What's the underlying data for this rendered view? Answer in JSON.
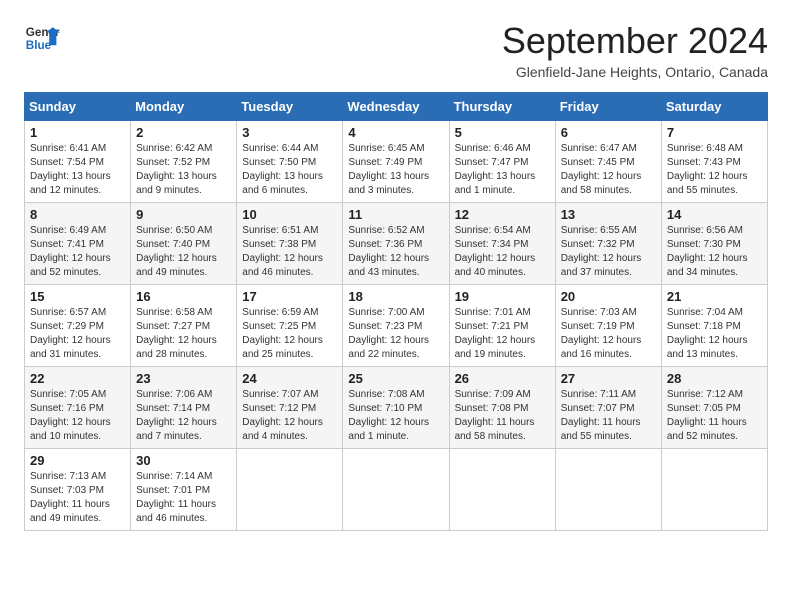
{
  "logo": {
    "line1": "General",
    "line2": "Blue"
  },
  "title": "September 2024",
  "location": "Glenfield-Jane Heights, Ontario, Canada",
  "days_of_week": [
    "Sunday",
    "Monday",
    "Tuesday",
    "Wednesday",
    "Thursday",
    "Friday",
    "Saturday"
  ],
  "weeks": [
    [
      {
        "day": "1",
        "sunrise": "Sunrise: 6:41 AM",
        "sunset": "Sunset: 7:54 PM",
        "daylight": "Daylight: 13 hours and 12 minutes."
      },
      {
        "day": "2",
        "sunrise": "Sunrise: 6:42 AM",
        "sunset": "Sunset: 7:52 PM",
        "daylight": "Daylight: 13 hours and 9 minutes."
      },
      {
        "day": "3",
        "sunrise": "Sunrise: 6:44 AM",
        "sunset": "Sunset: 7:50 PM",
        "daylight": "Daylight: 13 hours and 6 minutes."
      },
      {
        "day": "4",
        "sunrise": "Sunrise: 6:45 AM",
        "sunset": "Sunset: 7:49 PM",
        "daylight": "Daylight: 13 hours and 3 minutes."
      },
      {
        "day": "5",
        "sunrise": "Sunrise: 6:46 AM",
        "sunset": "Sunset: 7:47 PM",
        "daylight": "Daylight: 13 hours and 1 minute."
      },
      {
        "day": "6",
        "sunrise": "Sunrise: 6:47 AM",
        "sunset": "Sunset: 7:45 PM",
        "daylight": "Daylight: 12 hours and 58 minutes."
      },
      {
        "day": "7",
        "sunrise": "Sunrise: 6:48 AM",
        "sunset": "Sunset: 7:43 PM",
        "daylight": "Daylight: 12 hours and 55 minutes."
      }
    ],
    [
      {
        "day": "8",
        "sunrise": "Sunrise: 6:49 AM",
        "sunset": "Sunset: 7:41 PM",
        "daylight": "Daylight: 12 hours and 52 minutes."
      },
      {
        "day": "9",
        "sunrise": "Sunrise: 6:50 AM",
        "sunset": "Sunset: 7:40 PM",
        "daylight": "Daylight: 12 hours and 49 minutes."
      },
      {
        "day": "10",
        "sunrise": "Sunrise: 6:51 AM",
        "sunset": "Sunset: 7:38 PM",
        "daylight": "Daylight: 12 hours and 46 minutes."
      },
      {
        "day": "11",
        "sunrise": "Sunrise: 6:52 AM",
        "sunset": "Sunset: 7:36 PM",
        "daylight": "Daylight: 12 hours and 43 minutes."
      },
      {
        "day": "12",
        "sunrise": "Sunrise: 6:54 AM",
        "sunset": "Sunset: 7:34 PM",
        "daylight": "Daylight: 12 hours and 40 minutes."
      },
      {
        "day": "13",
        "sunrise": "Sunrise: 6:55 AM",
        "sunset": "Sunset: 7:32 PM",
        "daylight": "Daylight: 12 hours and 37 minutes."
      },
      {
        "day": "14",
        "sunrise": "Sunrise: 6:56 AM",
        "sunset": "Sunset: 7:30 PM",
        "daylight": "Daylight: 12 hours and 34 minutes."
      }
    ],
    [
      {
        "day": "15",
        "sunrise": "Sunrise: 6:57 AM",
        "sunset": "Sunset: 7:29 PM",
        "daylight": "Daylight: 12 hours and 31 minutes."
      },
      {
        "day": "16",
        "sunrise": "Sunrise: 6:58 AM",
        "sunset": "Sunset: 7:27 PM",
        "daylight": "Daylight: 12 hours and 28 minutes."
      },
      {
        "day": "17",
        "sunrise": "Sunrise: 6:59 AM",
        "sunset": "Sunset: 7:25 PM",
        "daylight": "Daylight: 12 hours and 25 minutes."
      },
      {
        "day": "18",
        "sunrise": "Sunrise: 7:00 AM",
        "sunset": "Sunset: 7:23 PM",
        "daylight": "Daylight: 12 hours and 22 minutes."
      },
      {
        "day": "19",
        "sunrise": "Sunrise: 7:01 AM",
        "sunset": "Sunset: 7:21 PM",
        "daylight": "Daylight: 12 hours and 19 minutes."
      },
      {
        "day": "20",
        "sunrise": "Sunrise: 7:03 AM",
        "sunset": "Sunset: 7:19 PM",
        "daylight": "Daylight: 12 hours and 16 minutes."
      },
      {
        "day": "21",
        "sunrise": "Sunrise: 7:04 AM",
        "sunset": "Sunset: 7:18 PM",
        "daylight": "Daylight: 12 hours and 13 minutes."
      }
    ],
    [
      {
        "day": "22",
        "sunrise": "Sunrise: 7:05 AM",
        "sunset": "Sunset: 7:16 PM",
        "daylight": "Daylight: 12 hours and 10 minutes."
      },
      {
        "day": "23",
        "sunrise": "Sunrise: 7:06 AM",
        "sunset": "Sunset: 7:14 PM",
        "daylight": "Daylight: 12 hours and 7 minutes."
      },
      {
        "day": "24",
        "sunrise": "Sunrise: 7:07 AM",
        "sunset": "Sunset: 7:12 PM",
        "daylight": "Daylight: 12 hours and 4 minutes."
      },
      {
        "day": "25",
        "sunrise": "Sunrise: 7:08 AM",
        "sunset": "Sunset: 7:10 PM",
        "daylight": "Daylight: 12 hours and 1 minute."
      },
      {
        "day": "26",
        "sunrise": "Sunrise: 7:09 AM",
        "sunset": "Sunset: 7:08 PM",
        "daylight": "Daylight: 11 hours and 58 minutes."
      },
      {
        "day": "27",
        "sunrise": "Sunrise: 7:11 AM",
        "sunset": "Sunset: 7:07 PM",
        "daylight": "Daylight: 11 hours and 55 minutes."
      },
      {
        "day": "28",
        "sunrise": "Sunrise: 7:12 AM",
        "sunset": "Sunset: 7:05 PM",
        "daylight": "Daylight: 11 hours and 52 minutes."
      }
    ],
    [
      {
        "day": "29",
        "sunrise": "Sunrise: 7:13 AM",
        "sunset": "Sunset: 7:03 PM",
        "daylight": "Daylight: 11 hours and 49 minutes."
      },
      {
        "day": "30",
        "sunrise": "Sunrise: 7:14 AM",
        "sunset": "Sunset: 7:01 PM",
        "daylight": "Daylight: 11 hours and 46 minutes."
      },
      null,
      null,
      null,
      null,
      null
    ]
  ]
}
